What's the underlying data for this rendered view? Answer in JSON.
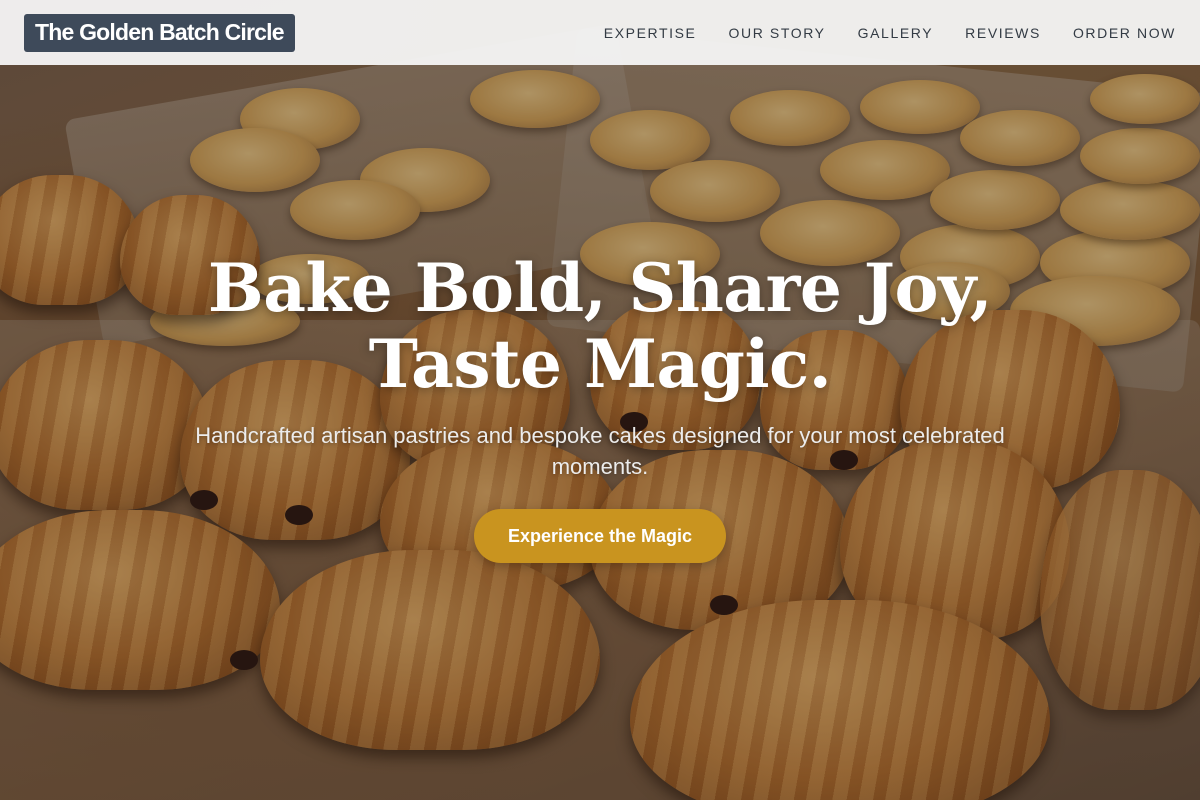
{
  "header": {
    "brand": "The Golden Batch Circle",
    "nav": [
      {
        "label": "EXPERTISE"
      },
      {
        "label": "OUR STORY"
      },
      {
        "label": "GALLERY"
      },
      {
        "label": "REVIEWS"
      },
      {
        "label": "ORDER NOW"
      }
    ]
  },
  "hero": {
    "title_line1": "Bake Bold, Share Joy,",
    "title_line2": "Taste Magic.",
    "subtitle": "Handcrafted artisan pastries and bespoke cakes designed for your most celebrated moments.",
    "cta_label": "Experience the Magic",
    "background_image": "pastry-tray-photo"
  },
  "colors": {
    "brand_bg": "#3e4a5a",
    "cta": "#c9941f",
    "nav_text": "#333b44"
  }
}
